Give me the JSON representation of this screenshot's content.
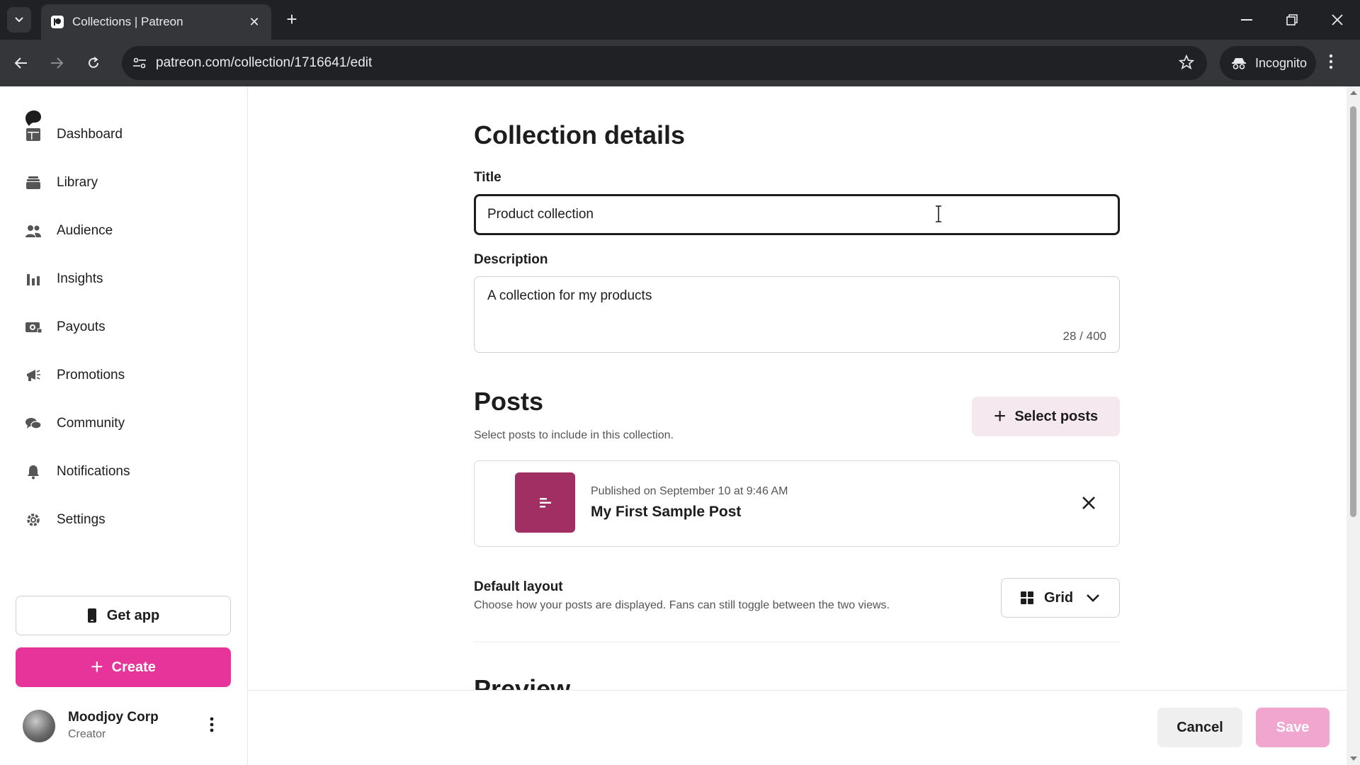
{
  "browser": {
    "tab_title": "Collections | Patreon",
    "tab_close": "✕",
    "new_tab": "+",
    "url": "patreon.com/collection/1716641/edit",
    "incognito_label": "Incognito"
  },
  "sidebar": {
    "items": [
      {
        "label": "Dashboard",
        "icon": "dashboard-icon"
      },
      {
        "label": "Library",
        "icon": "library-icon"
      },
      {
        "label": "Audience",
        "icon": "audience-icon"
      },
      {
        "label": "Insights",
        "icon": "insights-icon"
      },
      {
        "label": "Payouts",
        "icon": "payouts-icon"
      },
      {
        "label": "Promotions",
        "icon": "promotions-icon"
      },
      {
        "label": "Community",
        "icon": "community-icon"
      },
      {
        "label": "Notifications",
        "icon": "notifications-icon"
      },
      {
        "label": "Settings",
        "icon": "settings-icon"
      }
    ],
    "get_app_label": "Get app",
    "create_label": "Create",
    "create_plus": "+",
    "user": {
      "name": "Moodjoy Corp",
      "role": "Creator"
    }
  },
  "main": {
    "heading": "Collection details",
    "title_label": "Title",
    "title_value": "Product collection",
    "description_label": "Description",
    "description_value": "A collection for my products",
    "description_count": "28 / 400",
    "posts_heading": "Posts",
    "posts_subtitle": "Select posts to include in this collection.",
    "select_posts_label": "Select posts",
    "select_plus": "+",
    "post": {
      "meta": "Published on September 10 at 9:46 AM",
      "title": "My First Sample Post"
    },
    "layout_label": "Default layout",
    "layout_subtitle": "Choose how your posts are displayed. Fans can still toggle between the two views.",
    "layout_value": "Grid",
    "preview_heading": "Preview"
  },
  "actions": {
    "cancel_label": "Cancel",
    "save_label": "Save"
  },
  "colors": {
    "brand_pink": "#e6349b",
    "save_disabled": "#f0a6cf",
    "post_thumb": "#a12f63",
    "select_posts_bg": "#f6e8ef"
  }
}
